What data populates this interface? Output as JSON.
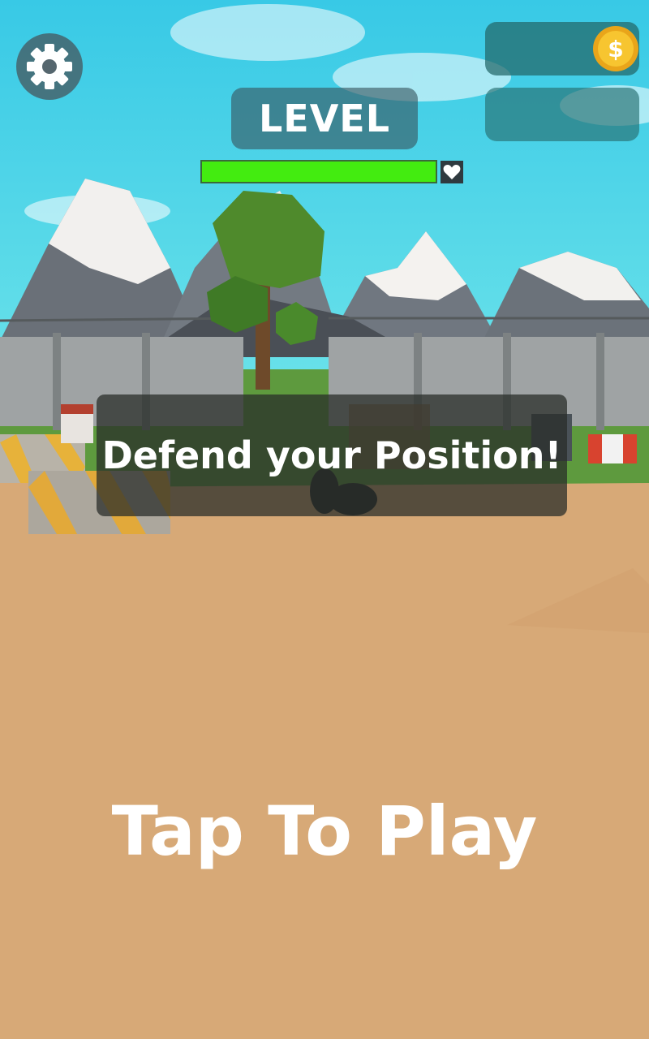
{
  "hud": {
    "level_label": "LEVEL",
    "health_fraction": 1.0,
    "coin_icon_symbol": "$",
    "coin_count": "",
    "gem_count": ""
  },
  "message": {
    "text": "Defend your Position!"
  },
  "prompt": {
    "text": "Tap To Play"
  },
  "icons": {
    "settings": "gear-icon",
    "coin": "coin-icon",
    "heart": "heart-icon"
  },
  "colors": {
    "sky": "#3fd2e6",
    "ground": "#d7a977",
    "health_fill": "#43ec10",
    "coin_gold": "#f5b921",
    "panel_teal": "#226668"
  }
}
